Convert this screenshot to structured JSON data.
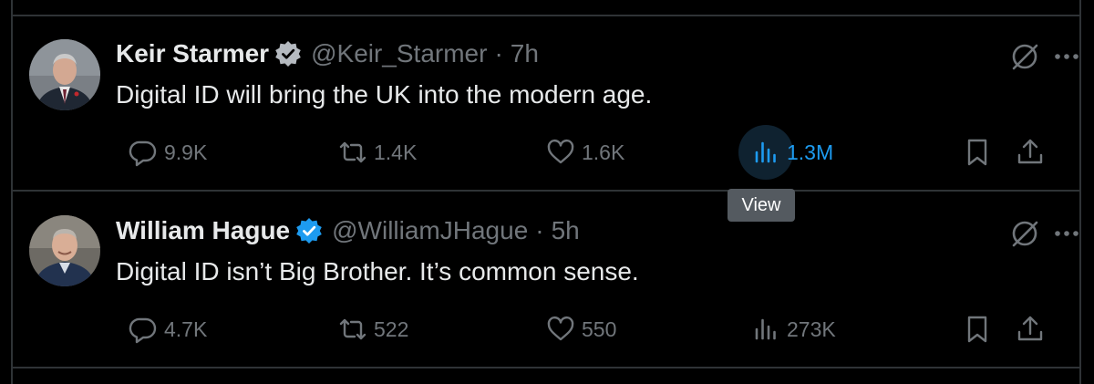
{
  "tweets": [
    {
      "name": "Keir Starmer",
      "handle": "@Keir_Starmer",
      "separator": "·",
      "time": "7h",
      "text": "Digital ID will bring the UK into the modern age.",
      "replies": "9.9K",
      "reposts": "1.4K",
      "likes": "1.6K",
      "views": "1.3M",
      "views_active": true
    },
    {
      "name": "William Hague",
      "handle": "@WilliamJHague",
      "separator": "·",
      "time": "5h",
      "text": "Digital ID isn’t Big Brother. It’s common sense.",
      "replies": "4.7K",
      "reposts": "522",
      "likes": "550",
      "views": "273K",
      "views_active": false
    }
  ],
  "tooltip": {
    "label": "View"
  },
  "colors": {
    "background": "#000000",
    "text_primary": "#e7e9ea",
    "text_secondary": "#71767b",
    "accent": "#1d9bf0",
    "divider": "#2f3336",
    "tooltip_bg": "#545a60"
  },
  "icons": {
    "verified": "verified-badge-icon",
    "grok": "grok-icon",
    "more": "more-icon",
    "reply": "reply-icon",
    "repost": "repost-icon",
    "like": "like-icon",
    "views": "views-icon",
    "bookmark": "bookmark-icon",
    "share": "share-icon"
  }
}
